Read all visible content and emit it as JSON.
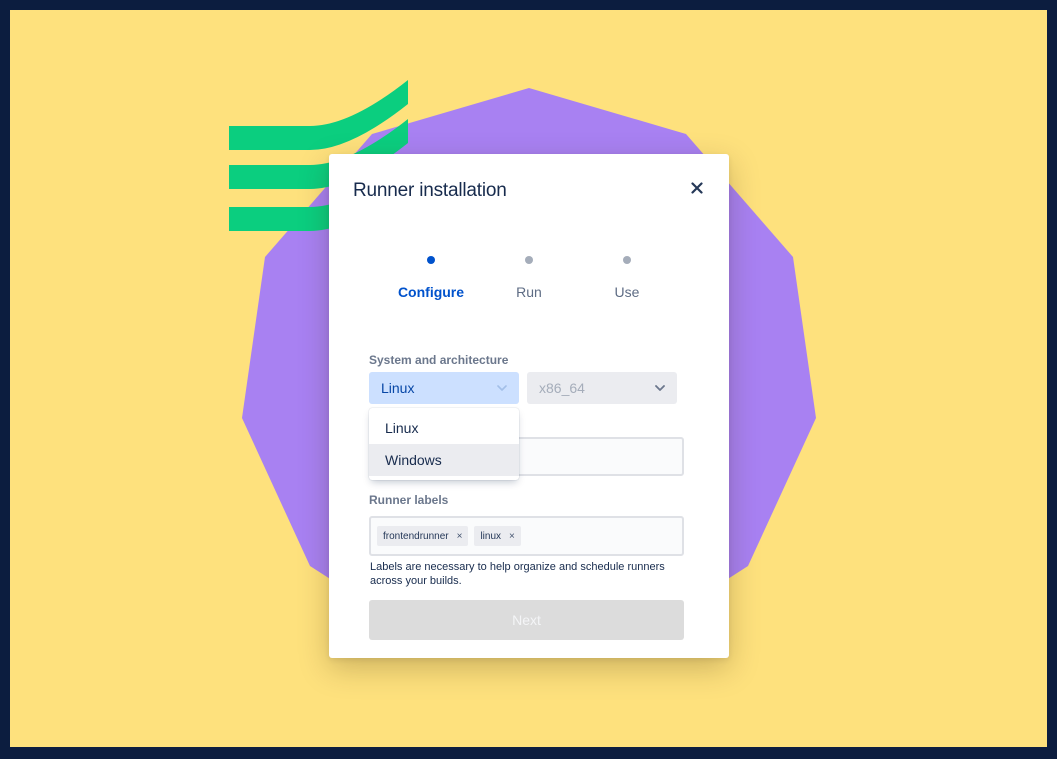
{
  "modal": {
    "title": "Runner installation",
    "close_icon": "close-icon"
  },
  "steps": [
    {
      "label": "Configure",
      "state": "active"
    },
    {
      "label": "Run",
      "state": "inactive"
    },
    {
      "label": "Use",
      "state": "inactive"
    }
  ],
  "system": {
    "label": "System and architecture",
    "os_value": "Linux",
    "arch_value": "x86_64",
    "os_options": [
      "Linux",
      "Windows"
    ],
    "hovered_option": "Windows"
  },
  "runner_labels": {
    "label": "Runner labels",
    "tags": [
      "frontendrunner",
      "linux"
    ],
    "remove_glyph": "×",
    "helper": "Labels are necessary to help organize and schedule runners across your builds."
  },
  "next_button": {
    "label": "Next",
    "disabled": true
  },
  "colors": {
    "frame": "#0c1d3f",
    "background": "#fee17d",
    "polygon": "#a881f2",
    "stripes": "#0bce7f",
    "accent": "#0052cc"
  }
}
